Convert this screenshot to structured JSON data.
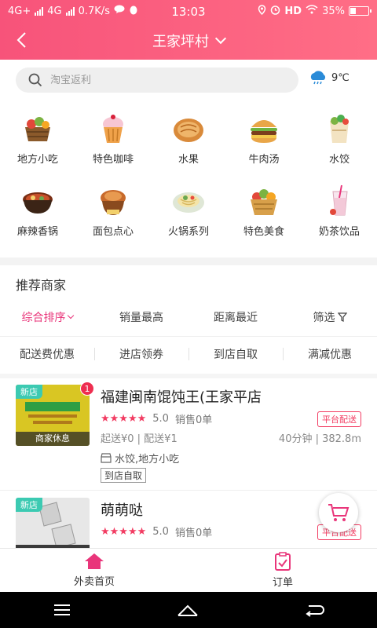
{
  "status_bar": {
    "network1": "4G+",
    "network2": "4G",
    "speed": "0.7K/s",
    "time": "13:03",
    "hd": "HD",
    "battery": "35%"
  },
  "header": {
    "location": "王家坪村",
    "accent": "#f7537a"
  },
  "search": {
    "placeholder": "淘宝返利"
  },
  "weather": {
    "temp": "9℃",
    "icon": "cloud-rain-icon"
  },
  "categories": [
    {
      "label": "地方小吃",
      "icon": "snack-basket-icon"
    },
    {
      "label": "特色咖啡",
      "icon": "cupcake-icon"
    },
    {
      "label": "水果",
      "icon": "pancake-icon"
    },
    {
      "label": "牛肉汤",
      "icon": "burger-icon"
    },
    {
      "label": "水饺",
      "icon": "salad-bag-icon"
    },
    {
      "label": "麻辣香锅",
      "icon": "hotpot-bowl-icon"
    },
    {
      "label": "面包点心",
      "icon": "bread-pot-icon"
    },
    {
      "label": "火锅系列",
      "icon": "noodle-plate-icon"
    },
    {
      "label": "特色美食",
      "icon": "fruit-basket-icon"
    },
    {
      "label": "奶茶饮品",
      "icon": "milk-tea-icon"
    }
  ],
  "section_title": "推荐商家",
  "sort_tabs": [
    "综合排序",
    "销量最高",
    "距离最近",
    "筛选"
  ],
  "filters": [
    "配送费优惠",
    "进店领券",
    "到店自取",
    "满减优惠"
  ],
  "stores": [
    {
      "name": "福建闽南馄饨王(王家平店",
      "badge": "新店",
      "thumb_status": "商家休息",
      "cart_count": "1",
      "rating": 5,
      "rating_text": "5.0",
      "sales": "销售0单",
      "delivery_badge": "平台配送",
      "delivery_info": "起送¥0 | 配送¥1",
      "eta": "40分钟 | 382.8m",
      "tags": "水饺,地方小吃",
      "pickup": "到店自取",
      "thumb_color": "#d9c623"
    },
    {
      "name": "萌萌哒",
      "badge": "新店",
      "rating": 5,
      "rating_text": "5.0",
      "sales": "销售0单",
      "delivery_badge": "平台配送",
      "thumb_color": "#e7e7e7"
    }
  ],
  "tabbar": [
    {
      "label": "外卖首页",
      "icon": "home-icon",
      "color": "#e9357a"
    },
    {
      "label": "订单",
      "icon": "order-icon",
      "color": "#e9357a"
    }
  ]
}
